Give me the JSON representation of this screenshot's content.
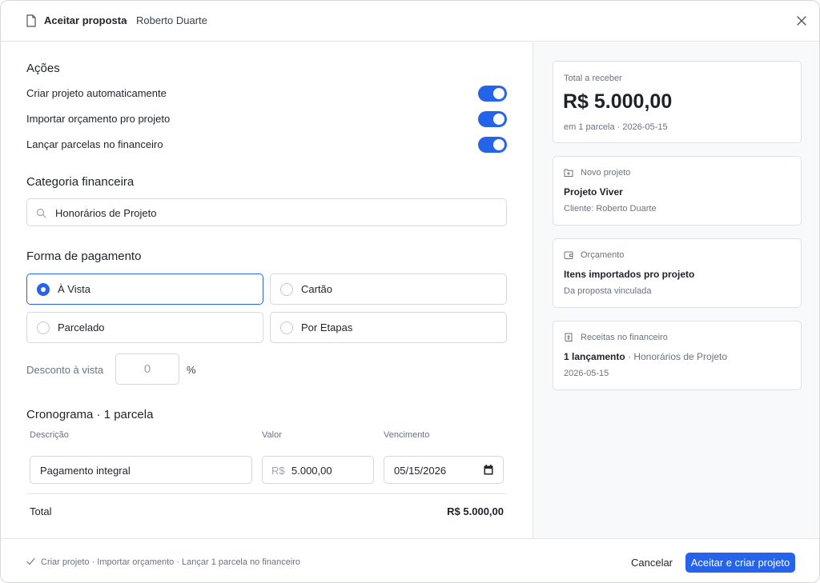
{
  "header": {
    "title": "Aceitar proposta",
    "separator": "·",
    "client": "Roberto Duarte"
  },
  "acoes": {
    "title": "Ações",
    "toggles": [
      {
        "label": "Criar projeto automaticamente",
        "on": true
      },
      {
        "label": "Importar orçamento pro projeto",
        "on": true
      },
      {
        "label": "Lançar parcelas no financeiro",
        "on": true
      }
    ]
  },
  "categoria": {
    "title": "Categoria financeira",
    "value": "Honorários de Projeto"
  },
  "pagamento": {
    "title": "Forma de pagamento",
    "options": [
      {
        "label": "À Vista",
        "selected": true
      },
      {
        "label": "Cartão",
        "selected": false
      },
      {
        "label": "Parcelado",
        "selected": false
      },
      {
        "label": "Por Etapas",
        "selected": false
      }
    ],
    "discount_label": "Desconto à vista",
    "discount_placeholder": "0",
    "discount_unit": "%"
  },
  "cronograma": {
    "title": "Cronograma · 1 parcela",
    "columns": [
      "Descrição",
      "Valor",
      "Vencimento"
    ],
    "row": {
      "descricao": "Pagamento integral",
      "currency_prefix": "R$",
      "valor": "5.000,00",
      "vencimento": "05/15/2026"
    },
    "total_label": "Total",
    "total_value": "R$ 5.000,00"
  },
  "summary_cards": {
    "total": {
      "label": "Total a receber",
      "amount": "R$ 5.000,00",
      "detail": "em 1 parcela · 2026-05-15"
    },
    "projeto": {
      "label": "Novo projeto",
      "name": "Projeto Viver",
      "detail": "Cliente: Roberto Duarte",
      "icon": "folder-plus-icon"
    },
    "orcamento": {
      "label": "Orçamento",
      "name": "Itens importados pro projeto",
      "detail": "Da proposta vinculada",
      "icon": "wallet-icon"
    },
    "receitas": {
      "label": "Receitas no financeiro",
      "count": "1 lançamento",
      "category": "· Honorários de Projeto",
      "date": "2026-05-15",
      "icon": "receipt-icon"
    }
  },
  "footer": {
    "summary": "Criar projeto · Importar orçamento · Lançar 1 parcela no financeiro",
    "cancel_label": "Cancelar",
    "confirm_label": "Aceitar e criar projeto"
  },
  "colors": {
    "accent": "#2563eb",
    "border": "#d6d8db",
    "muted_text": "#6b7280"
  }
}
